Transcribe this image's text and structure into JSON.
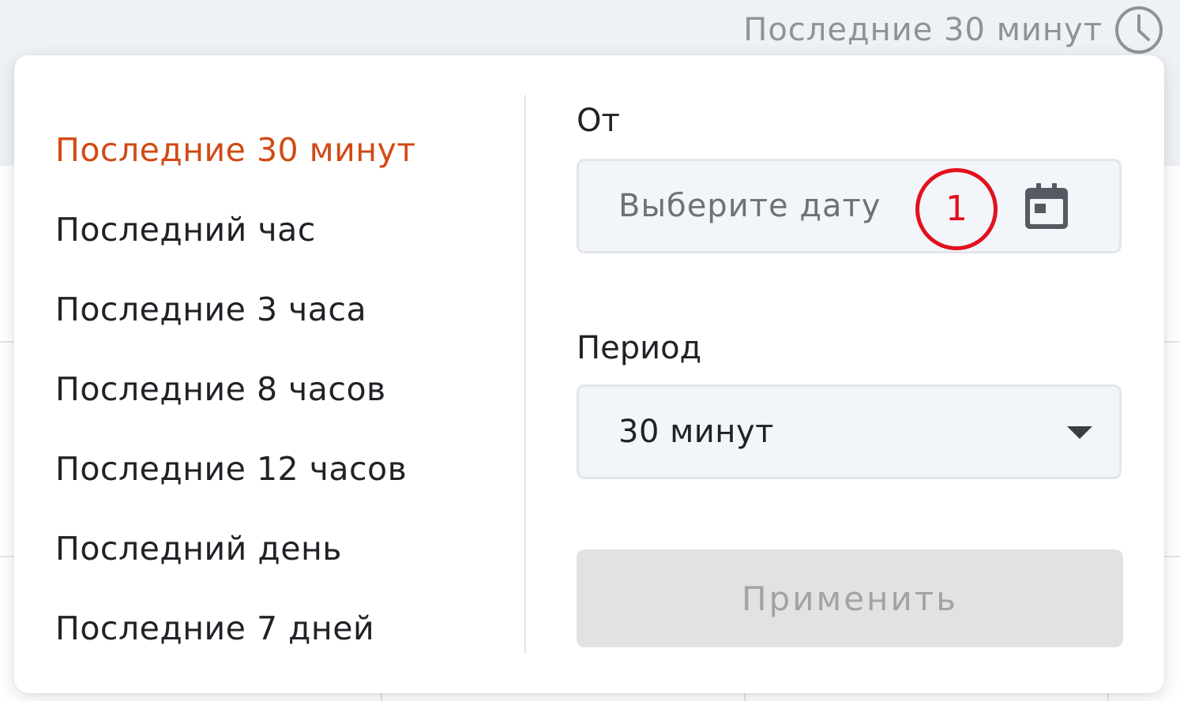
{
  "trigger": {
    "label": "Последние 30 минут",
    "icon": "clock-icon"
  },
  "presets": {
    "active_index": 0,
    "items": [
      {
        "label": "Последние 30 минут"
      },
      {
        "label": "Последний час"
      },
      {
        "label": "Последние 3 часа"
      },
      {
        "label": "Последние 8 часов"
      },
      {
        "label": "Последние 12 часов"
      },
      {
        "label": "Последний день"
      },
      {
        "label": "Последние 7 дней"
      }
    ]
  },
  "from": {
    "label": "От",
    "placeholder": "Выберите дату",
    "icon": "calendar-icon"
  },
  "annotation": {
    "marker": "1"
  },
  "period": {
    "label": "Период",
    "value": "30 минут",
    "icon": "chevron-down-icon"
  },
  "apply": {
    "label": "Применить",
    "disabled": true
  },
  "colors": {
    "accent": "#d24a14",
    "marker": "#e3101d",
    "muted_text": "#8f9296",
    "disabled_bg": "#e2e2e2"
  }
}
